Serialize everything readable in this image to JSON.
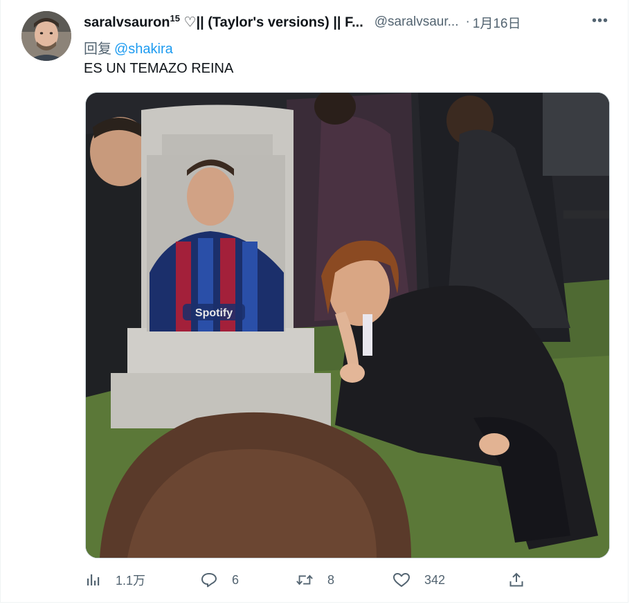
{
  "tweet": {
    "display_name": "saralvsauron",
    "display_name_sup": "15",
    "display_name_rest": " ♡|| (Taylor's versions) || F...",
    "handle": "@saralvsaur...",
    "separator": "·",
    "date": "1月16日",
    "more_label": "•••",
    "reply_prefix": "回复",
    "reply_mention": "@shakira",
    "text": "ES UN TEMAZO REINA",
    "media": {
      "jersey_text": "Spotify"
    }
  },
  "actions": {
    "views": {
      "icon": "analytics-icon",
      "count": "1.1万"
    },
    "replies": {
      "icon": "reply-icon",
      "count": "6"
    },
    "retweets": {
      "icon": "retweet-icon",
      "count": "8"
    },
    "likes": {
      "icon": "heart-icon",
      "count": "342"
    },
    "share": {
      "icon": "share-icon"
    }
  },
  "colors": {
    "text": "#0f1419",
    "secondary": "#536471",
    "link": "#1d9bf0",
    "border": "#cfd9de"
  }
}
